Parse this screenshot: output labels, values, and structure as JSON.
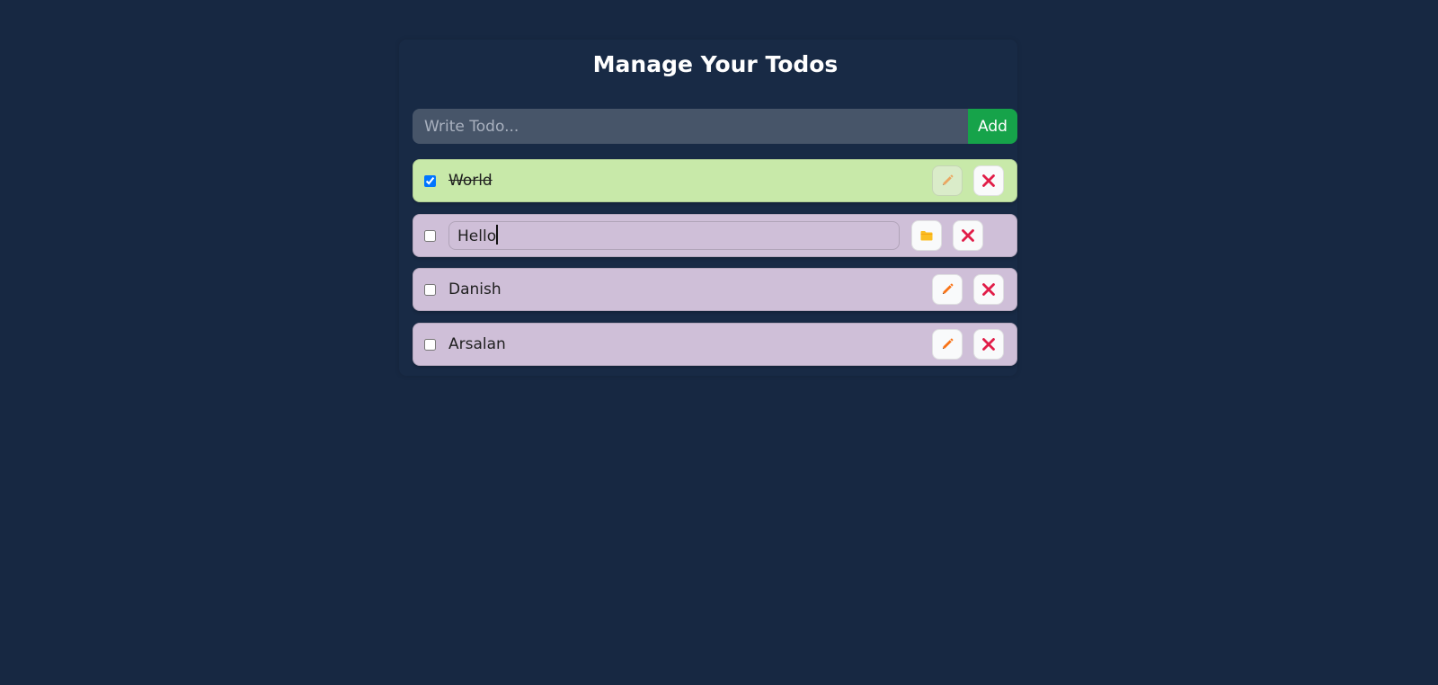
{
  "header": {
    "title": "Manage Your Todos"
  },
  "form": {
    "placeholder": "Write Todo...",
    "add_label": "Add"
  },
  "todos": [
    {
      "text": "World",
      "completed": true,
      "editing": false,
      "action_icon": "pencil-icon"
    },
    {
      "text": "Hello",
      "completed": false,
      "editing": true,
      "action_icon": "folder-icon"
    },
    {
      "text": "Danish",
      "completed": false,
      "editing": false,
      "action_icon": "pencil-icon"
    },
    {
      "text": "Arsalan",
      "completed": false,
      "editing": false,
      "action_icon": "pencil-icon"
    }
  ],
  "colors": {
    "background": "#172842",
    "input_background": "#475569",
    "add_button": "#16a34a",
    "completed_row": "#c8e9a9",
    "open_row": "#cfbfd8",
    "delete_icon": "#e11d48",
    "pencil_icon": "#f97316",
    "folder_icon": "#fbbf24"
  }
}
